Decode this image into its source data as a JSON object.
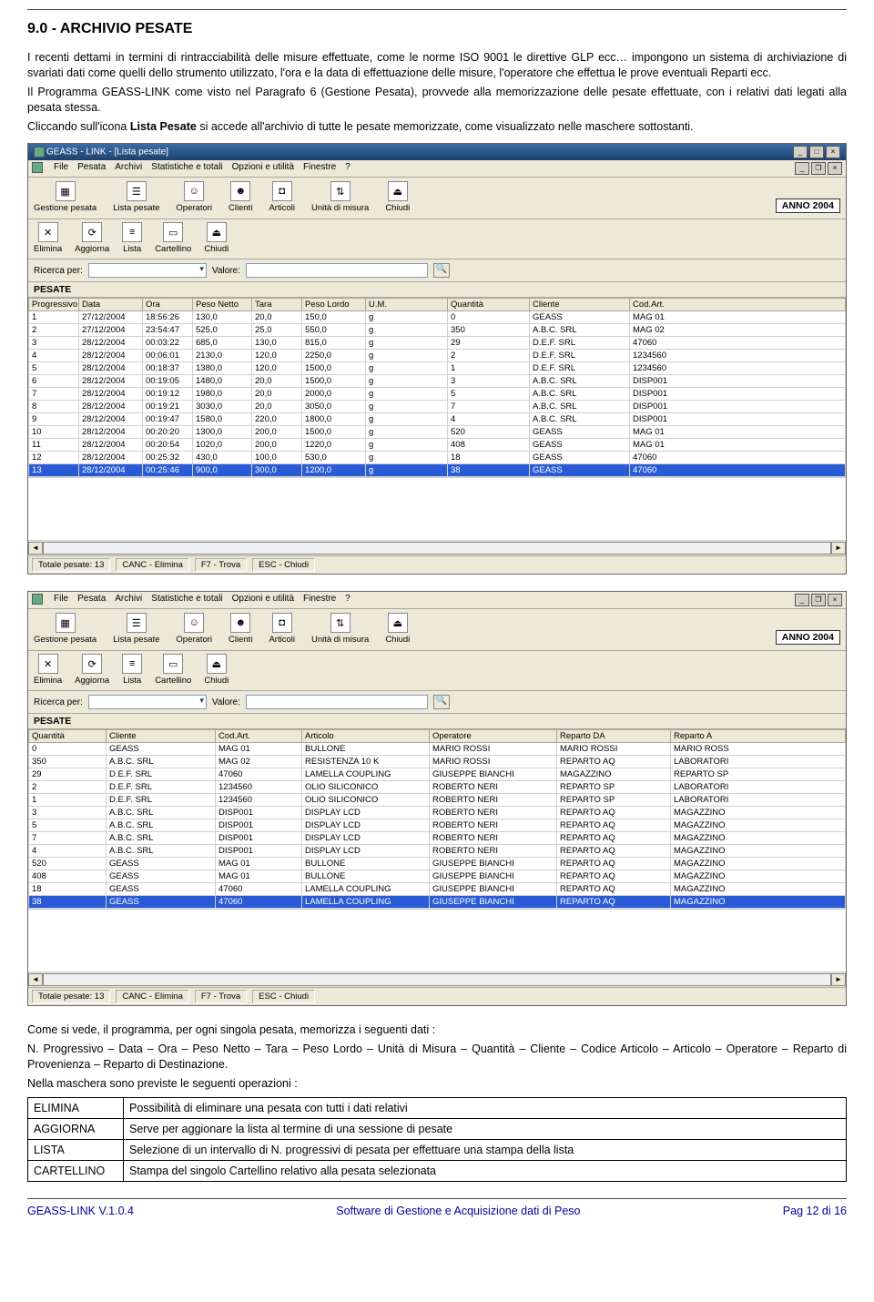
{
  "section_title": "9.0 -  ARCHIVIO PESATE",
  "para1": "I recenti dettami in termini di rintracciabilità delle misure effettuate, come le norme ISO 9001 le direttive GLP ecc… impongono un sistema di archiviazione di svariati dati come quelli dello strumento utilizzato, l'ora e la data di effettuazione delle misure, l'operatore che effettua le prove eventuali Reparti ecc.",
  "para2": "Il Programma GEASS-LINK come visto nel Paragrafo 6 (Gestione Pesata), provvede alla memorizzazione delle pesate effettuate, con i relativi dati legati alla pesata stessa.",
  "para3_a": "Cliccando sull'icona ",
  "para3_b": "Lista Pesate",
  "para3_c": " si accede all'archivio di tutte le pesate memorizzate, come  visualizzato nelle maschere sottostanti.",
  "win_title": "GEASS - LINK - [Lista pesate]",
  "menu": {
    "file": "File",
    "pesata": "Pesata",
    "archivi": "Archivi",
    "stats": "Statistiche e totali",
    "opz": "Opzioni e utilità",
    "fin": "Finestre",
    "help": "?"
  },
  "tool": {
    "gestione": "Gestione pesata",
    "lista": "Lista pesate",
    "operatori": "Operatori",
    "clienti": "Clienti",
    "articoli": "Articoli",
    "unita": "Unità di misura",
    "chiudi": "Chiudi",
    "anno": "ANNO 2004"
  },
  "sub": {
    "elimina": "Elimina",
    "aggiorna": "Aggiorna",
    "lista": "Lista",
    "cartellino": "Cartellino",
    "chiudi": "Chiudi"
  },
  "search": {
    "label": "Ricerca per:",
    "val_label": "Valore:"
  },
  "pesate_label": "PESATE",
  "cols1": [
    "Progressivo",
    "Data",
    "Ora",
    "Peso Netto",
    "Tara",
    "Peso Lordo",
    "U.M.",
    "Quantità",
    "Cliente",
    "Cod.Art."
  ],
  "rows1": [
    [
      "1",
      "27/12/2004",
      "18:56:26",
      "130,0",
      "20,0",
      "150,0",
      "g",
      "0",
      "GEASS",
      "MAG 01"
    ],
    [
      "2",
      "27/12/2004",
      "23:54:47",
      "525,0",
      "25,0",
      "550,0",
      "g",
      "350",
      "A.B.C. SRL",
      "MAG 02"
    ],
    [
      "3",
      "28/12/2004",
      "00:03:22",
      "685,0",
      "130,0",
      "815,0",
      "g",
      "29",
      "D.E.F. SRL",
      "47060"
    ],
    [
      "4",
      "28/12/2004",
      "00:06:01",
      "2130,0",
      "120,0",
      "2250,0",
      "g",
      "2",
      "D.E.F. SRL",
      "1234560"
    ],
    [
      "5",
      "28/12/2004",
      "00:18:37",
      "1380,0",
      "120,0",
      "1500,0",
      "g",
      "1",
      "D.E.F. SRL",
      "1234560"
    ],
    [
      "6",
      "28/12/2004",
      "00:19:05",
      "1480,0",
      "20,0",
      "1500,0",
      "g",
      "3",
      "A.B.C. SRL",
      "DISP001"
    ],
    [
      "7",
      "28/12/2004",
      "00:19:12",
      "1980,0",
      "20,0",
      "2000,0",
      "g",
      "5",
      "A.B.C. SRL",
      "DISP001"
    ],
    [
      "8",
      "28/12/2004",
      "00:19:21",
      "3030,0",
      "20,0",
      "3050,0",
      "g",
      "7",
      "A.B.C. SRL",
      "DISP001"
    ],
    [
      "9",
      "28/12/2004",
      "00:19:47",
      "1580,0",
      "220,0",
      "1800,0",
      "g",
      "4",
      "A.B.C. SRL",
      "DISP001"
    ],
    [
      "10",
      "28/12/2004",
      "00:20:20",
      "1300,0",
      "200,0",
      "1500,0",
      "g",
      "520",
      "GEASS",
      "MAG 01"
    ],
    [
      "11",
      "28/12/2004",
      "00:20:54",
      "1020,0",
      "200,0",
      "1220,0",
      "g",
      "408",
      "GEASS",
      "MAG 01"
    ],
    [
      "12",
      "28/12/2004",
      "00:25:32",
      "430,0",
      "100,0",
      "530,0",
      "g",
      "18",
      "GEASS",
      "47060"
    ],
    [
      "13",
      "28/12/2004",
      "00:25:46",
      "900,0",
      "300,0",
      "1200,0",
      "g",
      "38",
      "GEASS",
      "47060"
    ]
  ],
  "status": {
    "total": "Totale pesate: 13",
    "canc": "CANC - Elimina",
    "f7": "F7 - Trova",
    "esc": "ESC - Chiudi"
  },
  "cols2": [
    "Quantità",
    "Cliente",
    "Cod.Art.",
    "Articolo",
    "Operatore",
    "Reparto DA",
    "Reparto A"
  ],
  "rows2": [
    [
      "0",
      "GEASS",
      "MAG 01",
      "BULLONE",
      "MARIO ROSSI",
      "MARIO ROSSI",
      "MARIO ROSS"
    ],
    [
      "350",
      "A.B.C. SRL",
      "MAG 02",
      "RESISTENZA 10 K",
      "MARIO ROSSI",
      "REPARTO AQ",
      "LABORATORI"
    ],
    [
      "29",
      "D.E.F. SRL",
      "47060",
      "LAMELLA COUPLING",
      "GIUSEPPE BIANCHI",
      "MAGAZZINO",
      "REPARTO SP"
    ],
    [
      "2",
      "D.E.F. SRL",
      "1234560",
      "OLIO SILICONICO",
      "ROBERTO NERI",
      "REPARTO SP",
      "LABORATORI"
    ],
    [
      "1",
      "D.E.F. SRL",
      "1234560",
      "OLIO SILICONICO",
      "ROBERTO NERI",
      "REPARTO SP",
      "LABORATORI"
    ],
    [
      "3",
      "A.B.C. SRL",
      "DISP001",
      "DISPLAY LCD",
      "ROBERTO NERI",
      "REPARTO AQ",
      "MAGAZZINO"
    ],
    [
      "5",
      "A.B.C. SRL",
      "DISP001",
      "DISPLAY LCD",
      "ROBERTO NERI",
      "REPARTO AQ",
      "MAGAZZINO"
    ],
    [
      "7",
      "A.B.C. SRL",
      "DISP001",
      "DISPLAY LCD",
      "ROBERTO NERI",
      "REPARTO AQ",
      "MAGAZZINO"
    ],
    [
      "4",
      "A.B.C. SRL",
      "DISP001",
      "DISPLAY LCD",
      "ROBERTO NERI",
      "REPARTO AQ",
      "MAGAZZINO"
    ],
    [
      "520",
      "GEASS",
      "MAG 01",
      "BULLONE",
      "GIUSEPPE BIANCHI",
      "REPARTO AQ",
      "MAGAZZINO"
    ],
    [
      "408",
      "GEASS",
      "MAG 01",
      "BULLONE",
      "GIUSEPPE BIANCHI",
      "REPARTO AQ",
      "MAGAZZINO"
    ],
    [
      "18",
      "GEASS",
      "47060",
      "LAMELLA COUPLING",
      "GIUSEPPE BIANCHI",
      "REPARTO AQ",
      "MAGAZZINO"
    ],
    [
      "38",
      "GEASS",
      "47060",
      "LAMELLA COUPLING",
      "GIUSEPPE BIANCHI",
      "REPARTO AQ",
      "MAGAZZINO"
    ]
  ],
  "after1": "Come si vede, il programma, per ogni singola pesata, memorizza i seguenti dati :",
  "after2": "N. Progressivo – Data – Ora – Peso Netto – Tara – Peso Lordo – Unità di Misura – Quantità – Cliente – Codice Articolo – Articolo – Operatore – Reparto di Provenienza – Reparto di Destinazione.",
  "after3": "Nella maschera sono previste le seguenti operazioni :",
  "ops": [
    [
      "ELIMINA",
      "Possibilità  di eliminare una pesata con tutti i dati relativi"
    ],
    [
      "AGGIORNA",
      "Serve per aggionare la lista al termine di una sessione di pesate"
    ],
    [
      "LISTA",
      "Selezione di un intervallo di N. progressivi di pesata per effettuare una stampa della lista"
    ],
    [
      "CARTELLINO",
      "Stampa del singolo Cartellino relativo alla pesata selezionata"
    ]
  ],
  "footer": {
    "left": "GEASS-LINK V.1.0.4",
    "mid": "Software di Gestione e Acquisizione dati di Peso",
    "right": "Pag 12 di 16"
  }
}
